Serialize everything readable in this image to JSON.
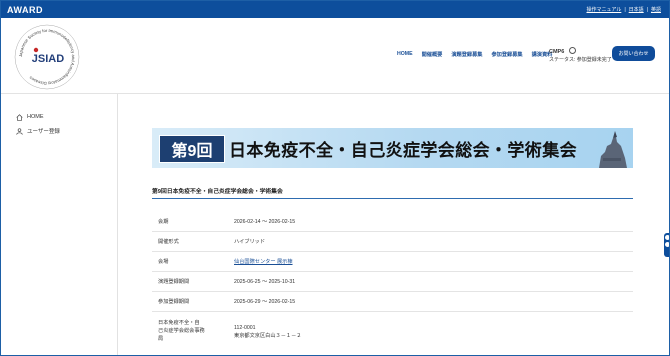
{
  "topbar": {
    "brand": "AWARD",
    "links": [
      "操作マニュアル",
      "日本語",
      "英語"
    ],
    "separator": "|"
  },
  "header": {
    "logo_text": "JSIAD",
    "logo_ring_text": "Japanese Society for Immunodeficiency and Autoinflammatory Diseases",
    "nav": [
      "HOME",
      "開催概要",
      "演題登録募集",
      "参加登録募集",
      "講演資料"
    ],
    "cmp_name": "CMP6",
    "cmp_status": "ステータス: 参加登録未完了",
    "contact_label": "お問い合わせ"
  },
  "sidebar": {
    "items": [
      {
        "label": "HOME",
        "icon": "home-icon"
      },
      {
        "label": "ユーザー登録",
        "icon": "user-icon"
      }
    ]
  },
  "main": {
    "banner_badge": "第9回",
    "banner_title": "日本免疫不全・自己炎症学会総会・学術集会",
    "event_title": "第9回日本免疫不全・自己炎症学会総会・学術集会",
    "table": [
      {
        "key": "会期",
        "value": "2026-02-14 ～ 2026-02-15"
      },
      {
        "key": "開催形式",
        "value": "ハイブリッド"
      },
      {
        "key": "会場",
        "value": "仙台国際センター 展示棟"
      },
      {
        "key": "演題登録期間",
        "value": "2025-06-25 ～ 2025-10-31"
      },
      {
        "key": "参加登録期間",
        "value": "2025-06-29 ～ 2026-02-15"
      },
      {
        "key_lines": [
          "日本免疫不全・自",
          "己炎症学会総会事務",
          "局"
        ],
        "value_lines": [
          "112-0001",
          "東京都文京区白山３－１－２"
        ]
      }
    ]
  },
  "colors": {
    "brand_blue": "#0d4e9c",
    "accent_red": "#c62828"
  }
}
